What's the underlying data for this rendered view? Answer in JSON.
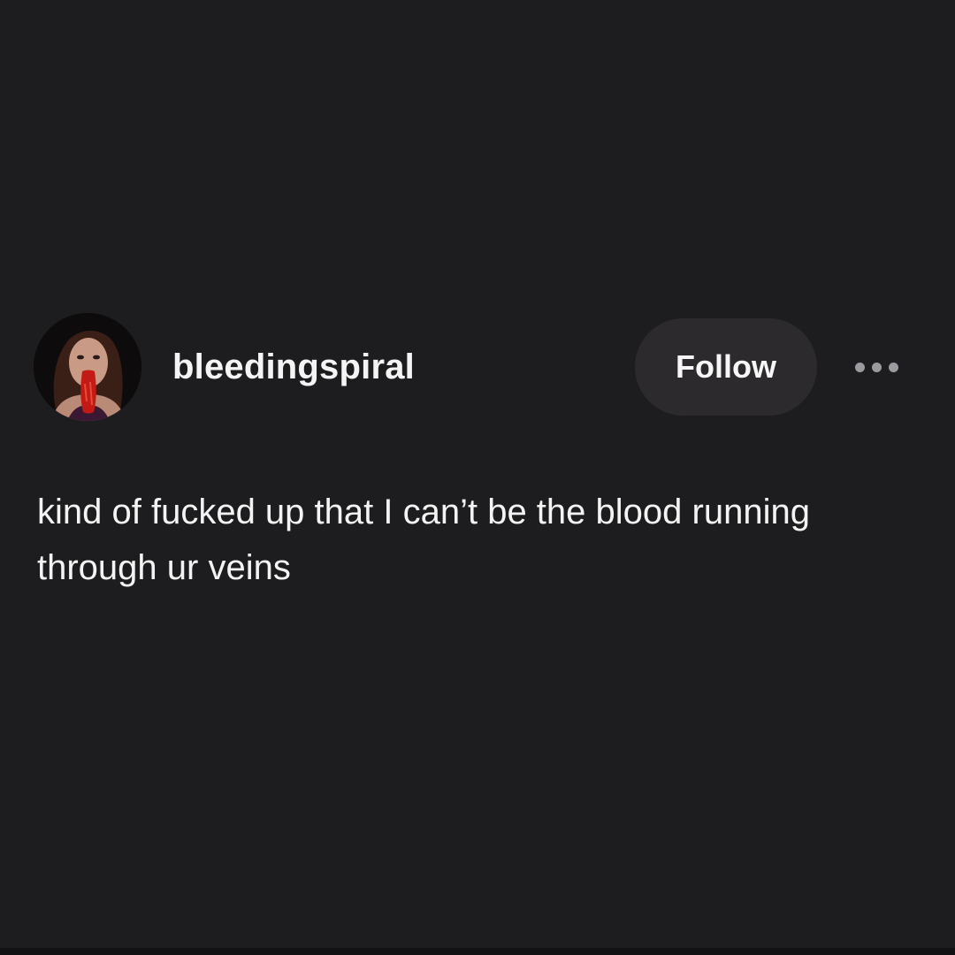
{
  "post": {
    "username": "bleedingspiral",
    "avatar_icon": "user-avatar",
    "follow_label": "Follow",
    "more_icon": "more-options-icon",
    "body_text": "kind of fucked up that I can’t be the blood running through ur veins"
  },
  "colors": {
    "background": "#1d1d1f",
    "button_background": "#2c2a2c",
    "text": "#f3f3f3",
    "dots": "#9c9a9e",
    "avatar_accent": "#c41a16"
  }
}
